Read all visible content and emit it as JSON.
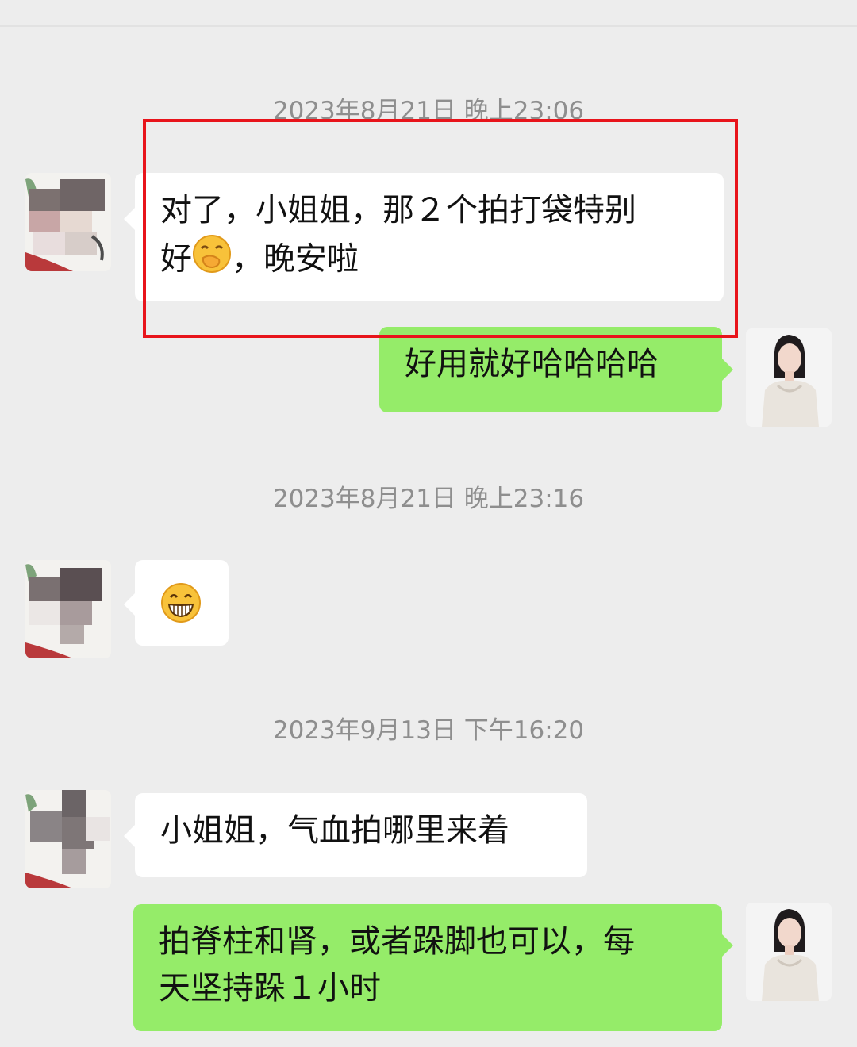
{
  "chat": {
    "timestamps": [
      "2023年8月21日 晚上23:06",
      "2023年8月21日 晚上23:16",
      "2023年9月13日 下午16:20"
    ],
    "messages": [
      {
        "side": "in",
        "line1": "对了，小姐姐，那２个拍打袋特别",
        "line2a": "好",
        "emoji": "hand-over-mouth-emoji",
        "line2b": "，晚安啦"
      },
      {
        "side": "out",
        "text": "好用就好哈哈哈哈"
      },
      {
        "side": "in",
        "emoji": "grinning-face-emoji"
      },
      {
        "side": "in",
        "text": "小姐姐，气血拍哪里来着"
      },
      {
        "side": "out",
        "line1": "拍脊柱和肾，或者跺脚也可以，每",
        "line2": "天坚持跺１小时"
      }
    ]
  },
  "colors": {
    "background": "#ededed",
    "incoming_bubble": "#ffffff",
    "outgoing_bubble": "#95ec69",
    "timestamp_text": "#8e8e8e",
    "highlight_box": "#e8141b"
  }
}
